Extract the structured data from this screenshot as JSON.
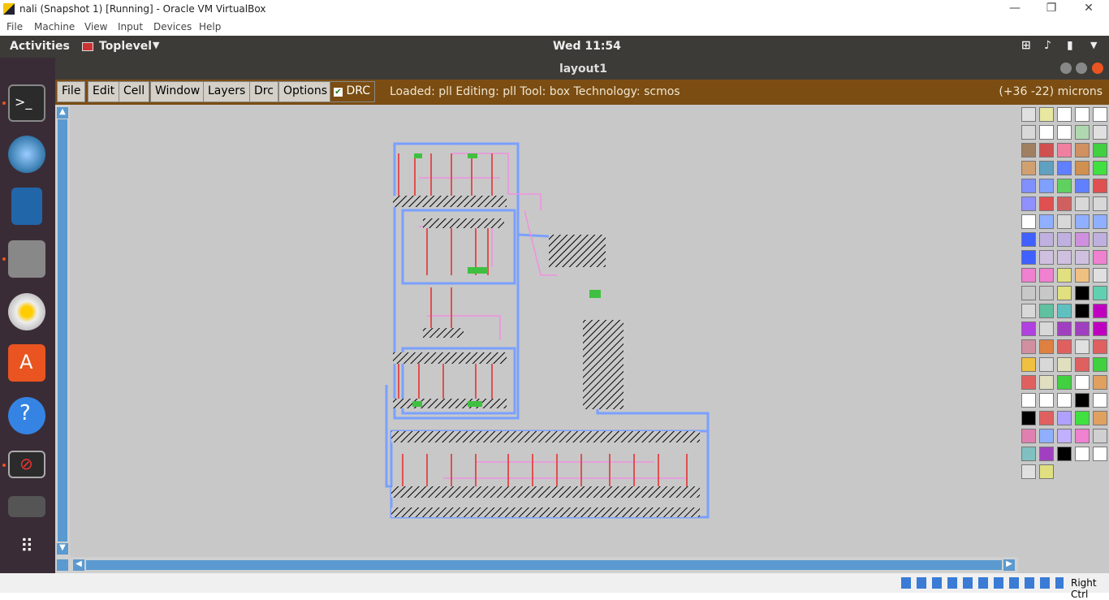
{
  "host": {
    "title": "nali (Snapshot 1) [Running] - Oracle VM VirtualBox",
    "menu": [
      "File",
      "Machine",
      "View",
      "Input",
      "Devices",
      "Help"
    ],
    "host_key": "Right Ctrl"
  },
  "gnome": {
    "activities": "Activities",
    "app_menu": "Toplevel",
    "clock": "Wed 11:54"
  },
  "window": {
    "title": "layout1"
  },
  "magic": {
    "menu": [
      "File",
      "Edit",
      "Cell",
      "Window",
      "Layers",
      "Drc",
      "Options"
    ],
    "drc_label": "DRC",
    "status": "Loaded: pll Editing: pll Tool: box  Technology: scmos",
    "coords": "(+36 -22) microns"
  },
  "dock_icons": [
    "terminal-icon",
    "thunderbird-icon",
    "writer-icon",
    "files-icon",
    "rhythmbox-icon",
    "software-center-icon",
    "help-icon",
    "no-entry-icon",
    "magic-icon",
    "show-apps-icon"
  ],
  "palette_colors": [
    "#e0e0e0",
    "#e8e8a0",
    "#ffffff",
    "#ffffff",
    "#ffffff",
    "#d8d8d8",
    "#ffffff",
    "#ffffff",
    "#b0d8b0",
    "#e0e0e0",
    "#a08060",
    "#d05050",
    "#f080a0",
    "#d09060",
    "#40d040",
    "#d0a070",
    "#60a0c0",
    "#6080ff",
    "#d09050",
    "#40e040",
    "#8090ff",
    "#80a0ff",
    "#60d060",
    "#6080ff",
    "#e05050",
    "#9090ff",
    "#e05050",
    "#d06060",
    "#d8d8d8",
    "#d8d8d8",
    "#ffffff",
    "#90b0ff",
    "#d8d8d8",
    "#90b0ff",
    "#90b0ff",
    "#4060ff",
    "#c0b0e0",
    "#c0b0e0",
    "#d090e0",
    "#c0b0e0",
    "#4060ff",
    "#d0c0e0",
    "#d0c0e0",
    "#d0c0e0",
    "#f080d0",
    "#f080d0",
    "#f080d0",
    "#e0e080",
    "#f0c080",
    "#e0e0e0",
    "#c8c8c8",
    "#c8c8c8",
    "#e0e080",
    "#000000",
    "#60d0b0",
    "#d8d8d8",
    "#60c0a0",
    "#60c0c0",
    "#000000",
    "#c000c0",
    "#b040e0",
    "#d8d8d8",
    "#a040c0",
    "#a040c0",
    "#c000c0",
    "#d090a0",
    "#e08040",
    "#e06060",
    "#e0e0e0",
    "#e06060",
    "#f0c040",
    "#d8d8d8",
    "#e0e0c0",
    "#e06060",
    "#40d040",
    "#e06060",
    "#e0e0c0",
    "#40d040",
    "#ffffff",
    "#e0a060",
    "#ffffff",
    "#ffffff",
    "#ffffff",
    "#000000",
    "#ffffff",
    "#000000",
    "#e06060",
    "#b0a0ff",
    "#40e040",
    "#e0a060",
    "#e080b0",
    "#90b0ff",
    "#c0b0ff",
    "#f080d0",
    "#d0d0d0",
    "#80c0c0",
    "#a040c0",
    "#000000",
    "#ffffff",
    "#ffffff",
    "#e0e0e0",
    "#e0e080"
  ]
}
